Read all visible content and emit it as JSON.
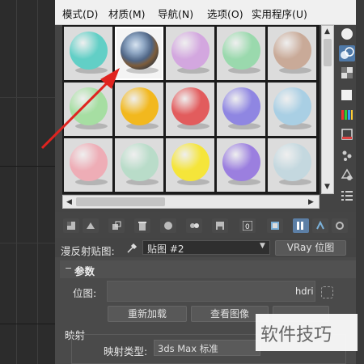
{
  "menu": [
    "模式(D)",
    "材质(M)",
    "导航(N)",
    "选项(O)",
    "实用程序(U)"
  ],
  "materials": [
    {
      "name": "slot-1",
      "color": "#62cfc6",
      "selected": false
    },
    {
      "name": "slot-2",
      "color": "environment",
      "selected": true
    },
    {
      "name": "slot-3",
      "color": "#d3a7df",
      "selected": false
    },
    {
      "name": "slot-4",
      "color": "#9ad9ad",
      "selected": false
    },
    {
      "name": "slot-5",
      "color": "#c9aa98",
      "selected": false
    },
    {
      "name": "slot-6",
      "color": "#a6dea2",
      "selected": false
    },
    {
      "name": "slot-7",
      "color": "#f2b81e",
      "selected": false
    },
    {
      "name": "slot-8",
      "color": "#e25c5d",
      "selected": false
    },
    {
      "name": "slot-9",
      "color": "#8f86e2",
      "selected": false
    },
    {
      "name": "slot-10",
      "color": "#a9cfe4",
      "selected": false
    },
    {
      "name": "slot-11",
      "color": "#eeadb6",
      "selected": false
    },
    {
      "name": "slot-12",
      "color": "#b9dcc9",
      "selected": false
    },
    {
      "name": "slot-13",
      "color": "#f5e53a",
      "selected": false
    },
    {
      "name": "slot-14",
      "color": "#9b7fdf",
      "selected": false
    },
    {
      "name": "slot-15",
      "color": "#c4d8df",
      "selected": false
    }
  ],
  "accent": "#e0231f",
  "diffuse_map": {
    "label": "漫反射贴图:",
    "map_value": "贴图 #2",
    "map_type_button": "VRay 位图"
  },
  "params": {
    "header": "参数",
    "bitmap_label": "位图:",
    "bitmap_value": "hdri",
    "reload_button": "重新加载",
    "view_image_button": "查看图像",
    "mapping_section": "映射",
    "mapping_type_label": "映射类型:",
    "mapping_type_value": "3ds Max 标准"
  },
  "watermark": "软件技巧"
}
